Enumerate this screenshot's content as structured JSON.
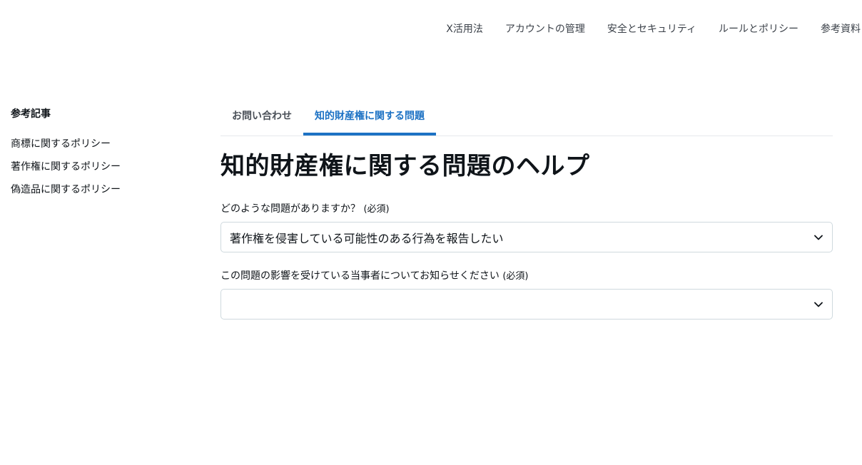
{
  "top_nav": {
    "items": [
      "X活用法",
      "アカウントの管理",
      "安全とセキュリティ",
      "ルールとポリシー",
      "参考資料"
    ]
  },
  "sidebar": {
    "title": "参考記事",
    "items": [
      "商標に関するポリシー",
      "著作権に関するポリシー",
      "偽造品に関するポリシー"
    ]
  },
  "tabs": [
    {
      "label": "お問い合わせ",
      "active": false
    },
    {
      "label": "知的財産権に関する問題",
      "active": true
    }
  ],
  "page_title": "知的財産権に関する問題のヘルプ",
  "form": {
    "field1": {
      "label": "どのような問題がありますか？",
      "required": "(必須)",
      "value": "著作権を侵害している可能性のある行為を報告したい"
    },
    "field2": {
      "label": "この問題の影響を受けている当事者についてお知らせください",
      "required": "(必須)",
      "value": ""
    }
  },
  "colors": {
    "accent": "#1d72c4",
    "border": "#cfd9de",
    "text": "#0f1419"
  },
  "icons": {
    "dropdown": "chevron-down-icon"
  }
}
